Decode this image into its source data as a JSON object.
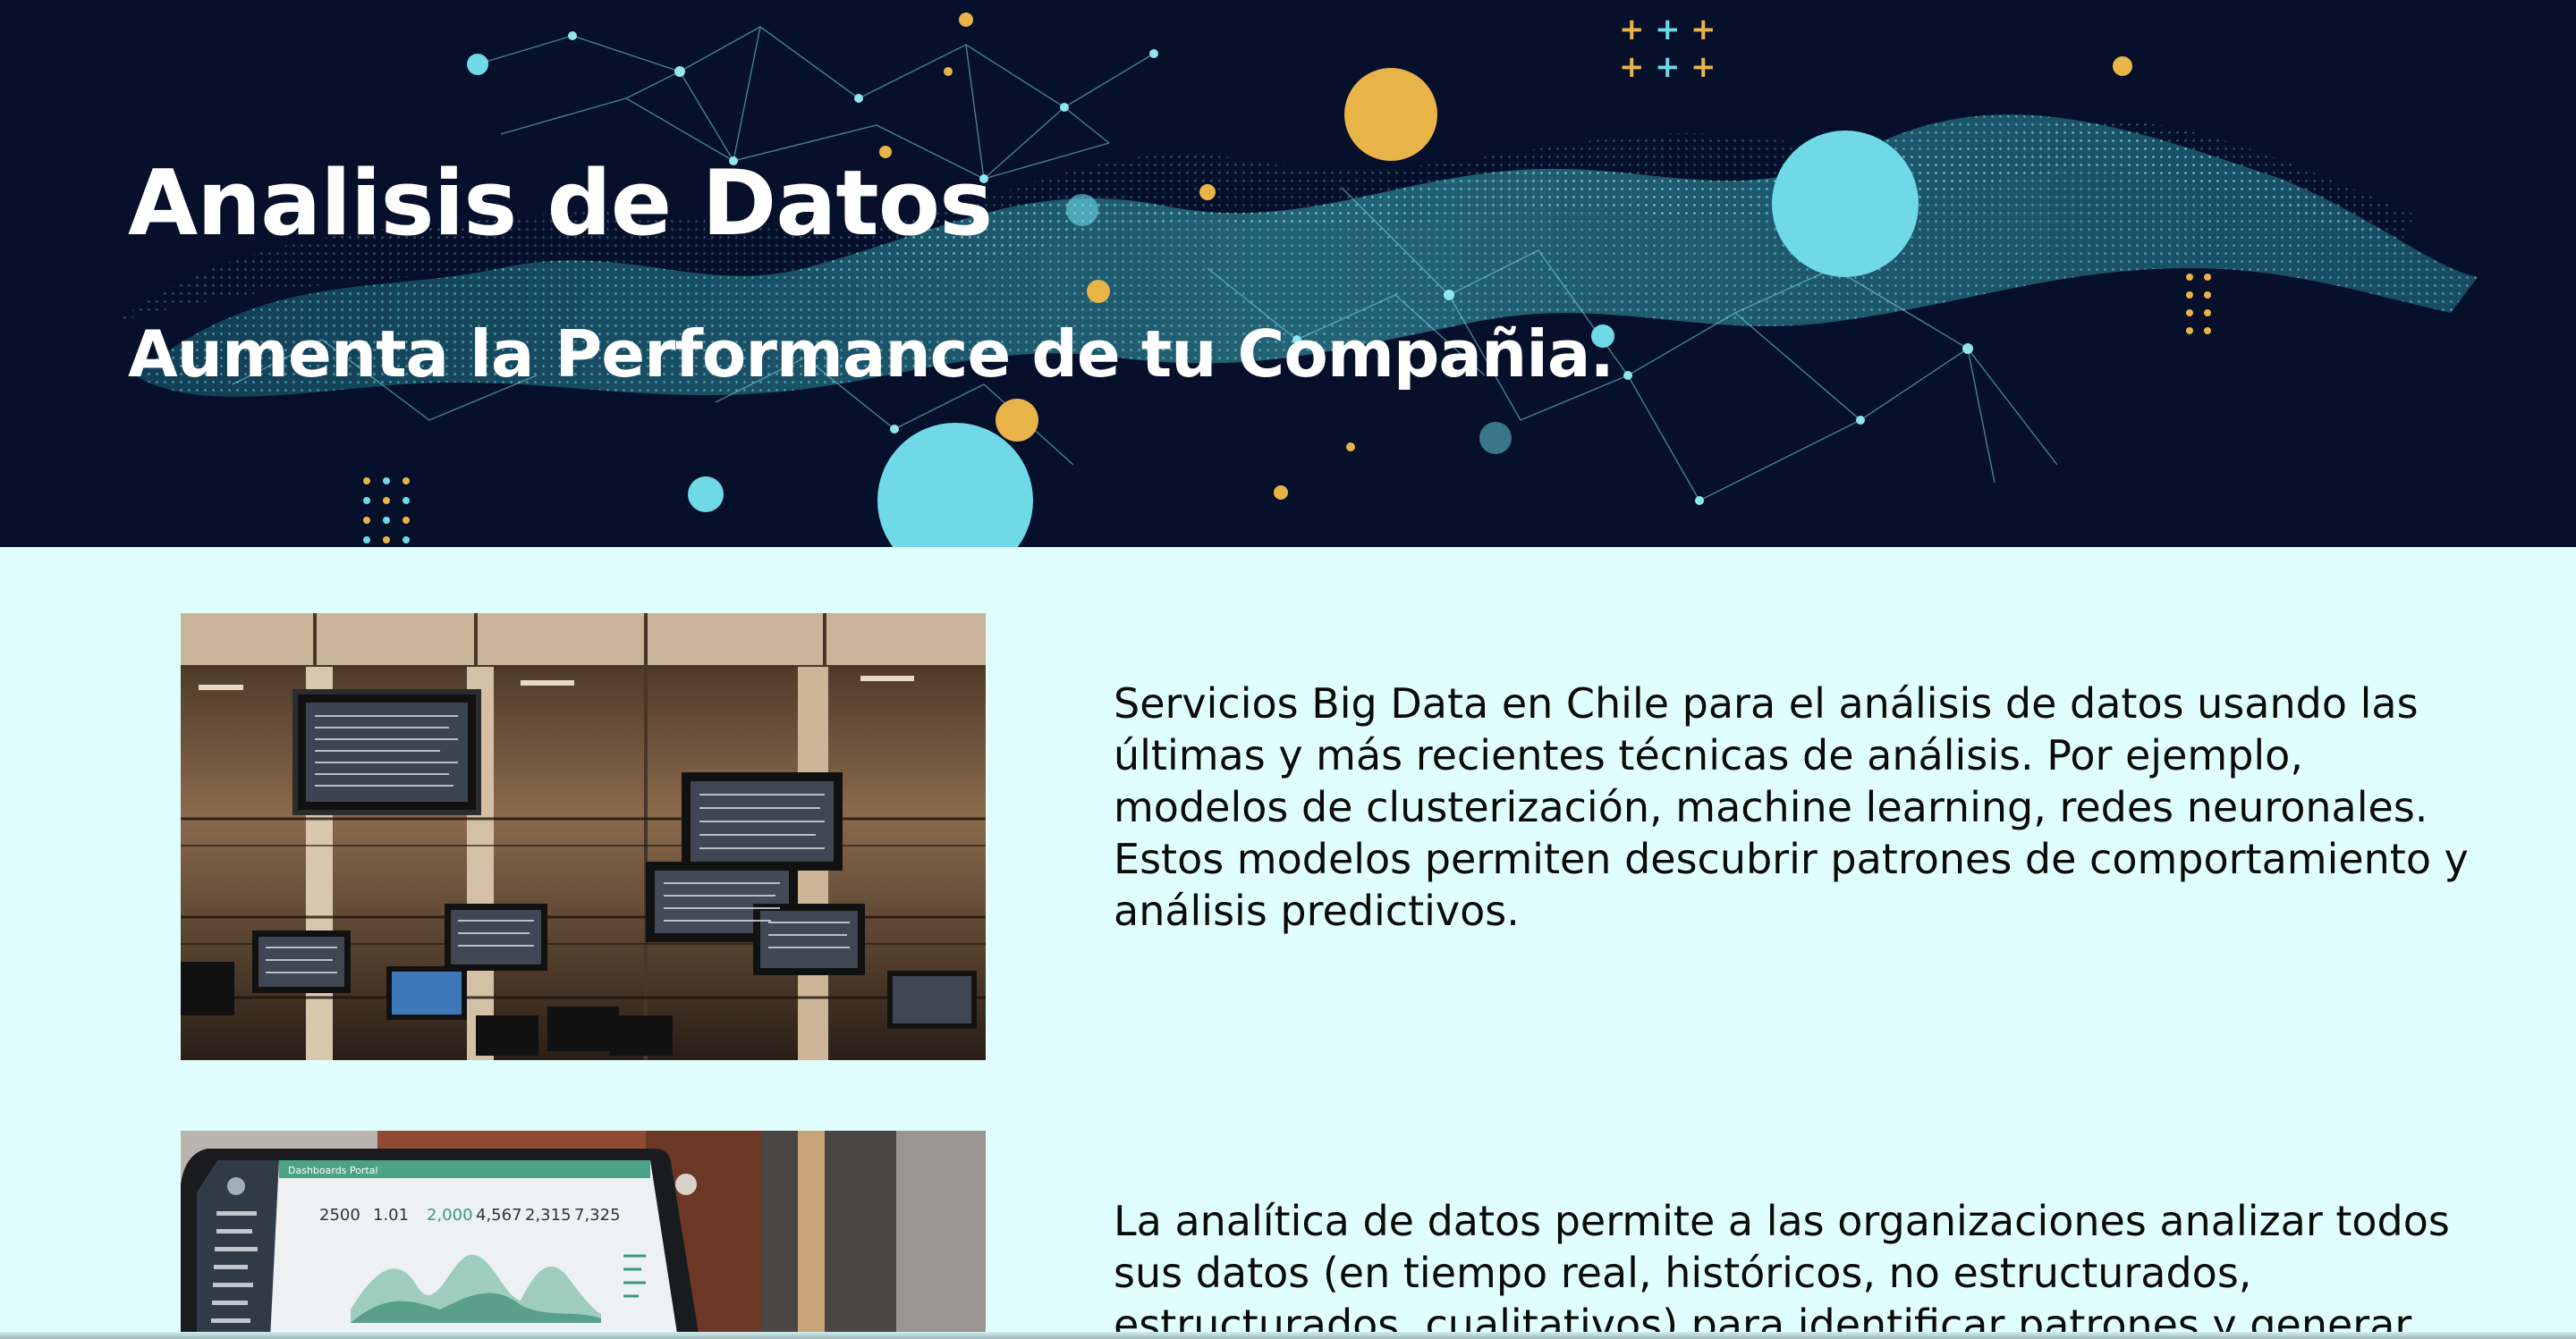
{
  "hero": {
    "title": "Analisis de Datos",
    "subtitle": "Aumenta la Performance de tu Compañia.",
    "colors": {
      "background": "#06102b",
      "wave": "#4fd8df",
      "accent_gold": "#e8b448",
      "accent_cyan": "#6fd9e8"
    }
  },
  "sections": [
    {
      "image": "data-center-monitors-image",
      "text": "Servicios Big Data en Chile para el análisis de datos usando las últimas y más recientes técnicas de análisis. Por ejemplo, modelos de clusterización, machine learning, redes neuronales. Estos modelos permiten descubrir patrones de comportamiento y análisis predictivos."
    },
    {
      "image": "laptop-dashboard-image",
      "text": "La analítica de datos permite a las organizaciones analizar todos sus datos (en tiempo real, históricos, no estructurados, estructurados, cualitativos) para identificar patrones y generar conocimientos para",
      "dashboard": {
        "app_name": "Dashboards Portal",
        "stats": [
          "2500",
          "1.01",
          "2,000",
          "4,567",
          "2,315",
          "7,325"
        ]
      }
    }
  ],
  "colors": {
    "page_background": "#e0fefe",
    "text": "#0b0b0b"
  }
}
